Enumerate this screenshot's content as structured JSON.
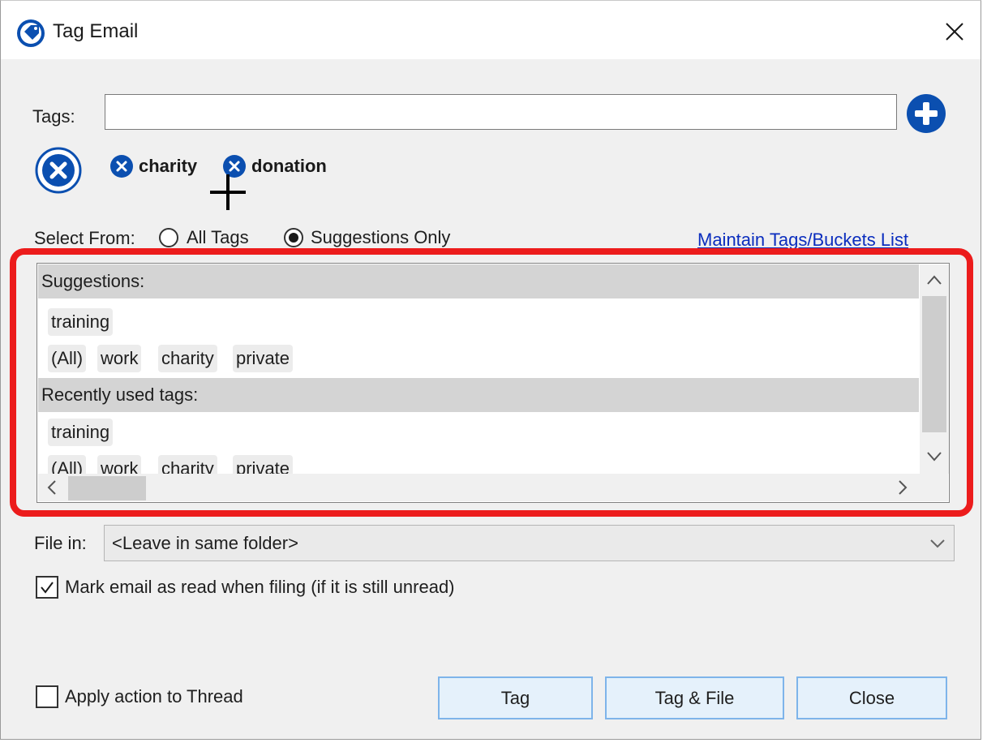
{
  "window": {
    "title": "Tag Email",
    "close_glyph": "✕"
  },
  "tags": {
    "label": "Tags:",
    "input_value": "",
    "selected": [
      {
        "label": "charity"
      },
      {
        "label": "donation"
      }
    ]
  },
  "select_from": {
    "label": "Select From:",
    "options": [
      {
        "label": "All Tags",
        "selected": false
      },
      {
        "label": "Suggestions Only",
        "selected": true
      }
    ]
  },
  "maintain_link": "Maintain Tags/Buckets List",
  "list": {
    "sections": [
      {
        "title": "Suggestions:",
        "rows": [
          [
            "training"
          ],
          [
            "(All)",
            "work",
            "charity",
            "private"
          ]
        ]
      },
      {
        "title": "Recently used tags:",
        "rows": [
          [
            "training"
          ],
          [
            "(All)",
            "work",
            "charity",
            "private"
          ]
        ]
      }
    ]
  },
  "file_in": {
    "label": "File in:",
    "value": "<Leave in same folder>"
  },
  "mark_read": {
    "label": "Mark email as read when filing (if it is still unread)",
    "checked": true
  },
  "apply_thread": {
    "label": "Apply action to Thread",
    "checked": false
  },
  "buttons": {
    "tag": "Tag",
    "tag_file": "Tag & File",
    "close": "Close"
  },
  "colors": {
    "accent_blue": "#0b4fb0",
    "highlight_red": "#ec1c1c",
    "link_blue": "#0a2dbe"
  }
}
